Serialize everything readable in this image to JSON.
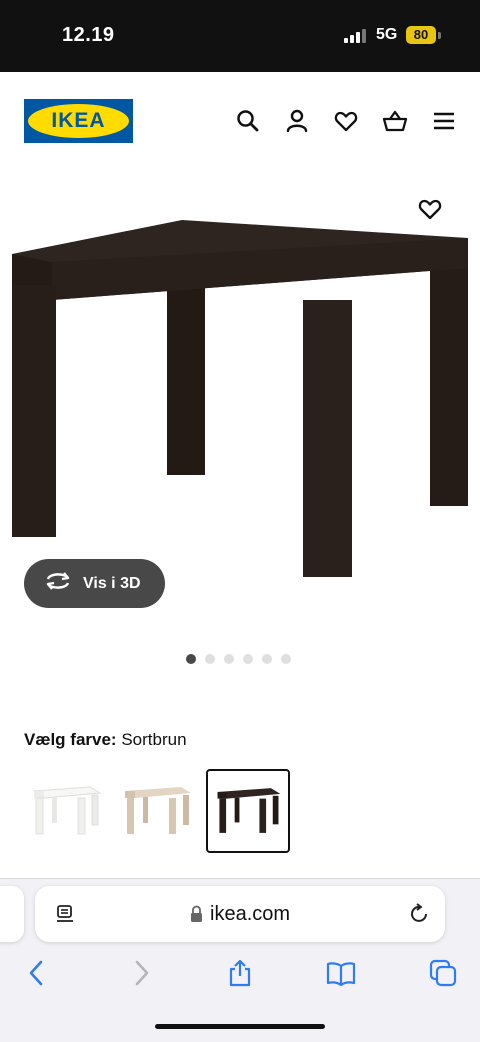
{
  "status_bar": {
    "time": "12.19",
    "network": "5G",
    "battery": "80"
  },
  "header": {
    "logo_text": "IKEA",
    "icons": [
      "search-icon",
      "account-icon",
      "heart-icon",
      "basket-icon",
      "menu-icon"
    ]
  },
  "product": {
    "image_alt": "LACK sidebord sortbrun",
    "view_3d_label": "Vis i 3D",
    "gallery_count": 6,
    "gallery_active": 0
  },
  "color_picker": {
    "label": "Vælg farve:",
    "selected": "Sortbrun",
    "options": [
      {
        "name": "Hvid",
        "color": "#f4f4f2"
      },
      {
        "name": "Hvidlaseret egeffekt",
        "color": "#d9c8b4"
      },
      {
        "name": "Sortbrun",
        "color": "#2b211d"
      }
    ]
  },
  "browser": {
    "url": "ikea.com",
    "icons": [
      "reader-icon",
      "lock-icon",
      "reload-icon",
      "back-icon",
      "forward-icon",
      "share-icon",
      "bookmarks-icon",
      "tabs-icon"
    ]
  },
  "colors": {
    "ikea_blue": "#0058a3",
    "ikea_yellow": "#ffdb00",
    "table_dark": "#2b211d"
  }
}
